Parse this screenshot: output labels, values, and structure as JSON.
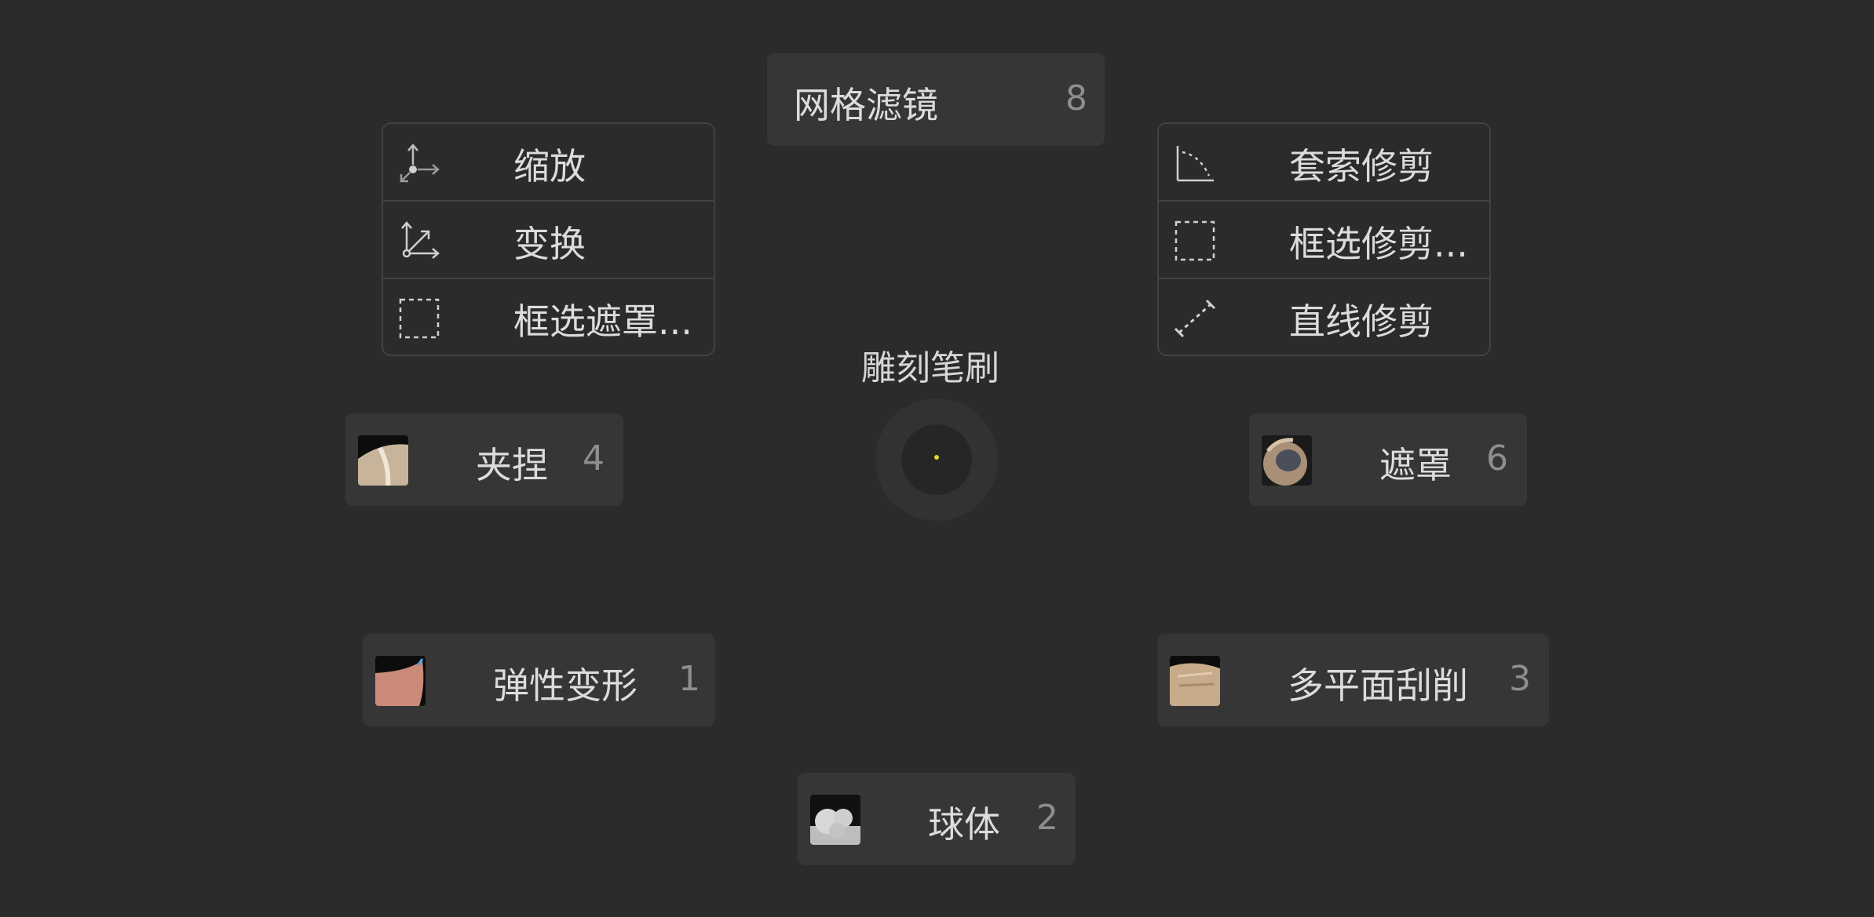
{
  "center": {
    "title": "雕刻笔刷"
  },
  "top_item": {
    "label": "网格滤镜",
    "shortcut": "8"
  },
  "left_group": [
    {
      "label": "缩放",
      "icon": "scale-icon"
    },
    {
      "label": "变换",
      "icon": "transform-icon"
    },
    {
      "label": "框选遮罩...",
      "icon": "box-select-icon"
    }
  ],
  "right_group": [
    {
      "label": "套索修剪",
      "icon": "lasso-icon"
    },
    {
      "label": "框选修剪...",
      "icon": "box-select-icon"
    },
    {
      "label": "直线修剪",
      "icon": "line-icon"
    }
  ],
  "brushes": {
    "pinch": {
      "label": "夹捏",
      "shortcut": "4"
    },
    "mask": {
      "label": "遮罩",
      "shortcut": "6"
    },
    "elastic": {
      "label": "弹性变形",
      "shortcut": "1"
    },
    "multiplane": {
      "label": "多平面刮削",
      "shortcut": "3"
    },
    "sphere": {
      "label": "球体",
      "shortcut": "2"
    }
  }
}
